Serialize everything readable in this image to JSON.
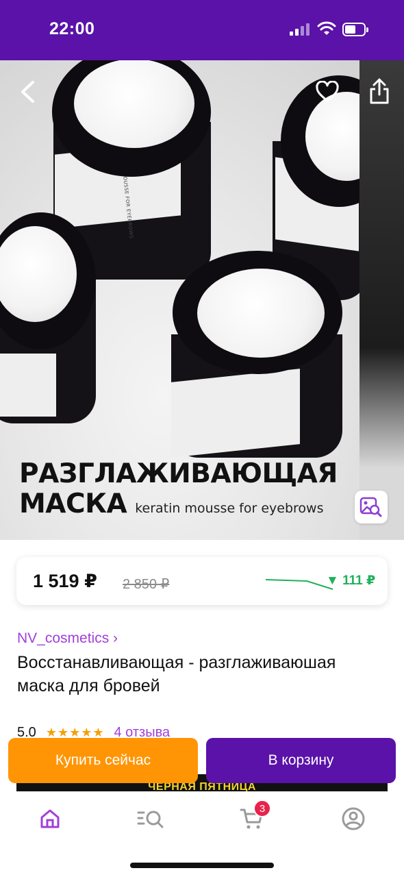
{
  "status_bar": {
    "time": "22:00"
  },
  "hero": {
    "title_line1": "РАЗГЛАЖИВАЮЩАЯ",
    "title_line2": "МАСКА",
    "subtitle": "keratin mousse for eyebrows",
    "jar_label": "KERATIN MOUSSE FOR EYEBROWS"
  },
  "price": {
    "current": "1 519 ₽",
    "old": "2 850 ₽",
    "drop": "▼ 111 ₽"
  },
  "product": {
    "seller": "NV_cosmetics ›",
    "title": "Восстанавливающая - разглаживаюшая маска для бровей",
    "rating": "5.0",
    "stars": "★★★★★",
    "reviews": "4 отзыва"
  },
  "promo": {
    "text": "ЧЁРНАЯ ПЯТНИЦА"
  },
  "actions": {
    "buy_now": "Купить сейчас",
    "add_to_cart": "В корзину"
  },
  "tab_bar": {
    "cart_badge": "3",
    "tabs": [
      "home-icon",
      "catalog-search-icon",
      "cart-icon",
      "profile-icon"
    ]
  },
  "colors": {
    "brand": "#5a12a8",
    "accent": "#ff9505",
    "seller": "#a13fd8",
    "price_drop": "#1fb15a",
    "badge": "#e8234a"
  }
}
